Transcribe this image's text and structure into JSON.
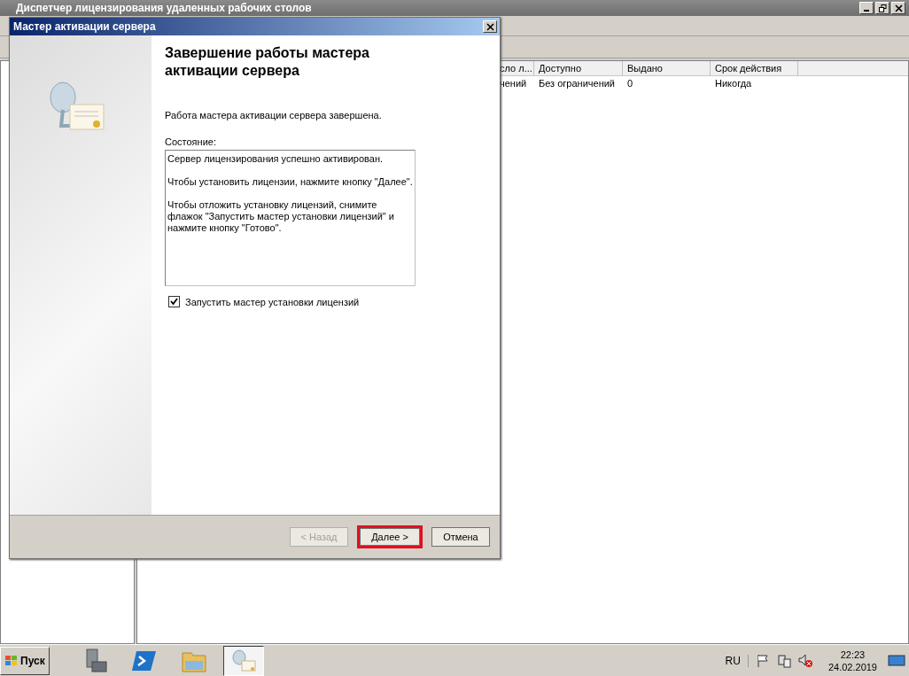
{
  "background_window": {
    "title": "Диспетчер лицензирования удаленных рабочих столов",
    "table": {
      "columns": [
        "сло л...",
        "Доступно",
        "Выдано",
        "Срок действия"
      ],
      "rows": [
        [
          "чений",
          "Без ограничений",
          "0",
          "Никогда"
        ]
      ]
    }
  },
  "dialog": {
    "title": "Мастер активации сервера",
    "heading": "Завершение работы мастера активации сервера",
    "intro": "Работа мастера активации сервера завершена.",
    "status_label": "Состояние:",
    "status_paragraphs": [
      "Сервер лицензирования успешно активирован.",
      "Чтобы установить лицензии, нажмите кнопку \"Далее\".",
      "Чтобы отложить установку лицензий, снимите флажок \"Запустить мастер установки лицензий\" и нажмите кнопку \"Готово\"."
    ],
    "checkbox": {
      "label": "Запустить мастер установки лицензий",
      "checked": true
    },
    "buttons": [
      {
        "label": "< Назад",
        "disabled": true,
        "highlighted": false
      },
      {
        "label": "Далее >",
        "disabled": false,
        "highlighted": true
      },
      {
        "label": "Отмена",
        "disabled": false,
        "highlighted": false
      }
    ]
  },
  "taskbar": {
    "start_label": "Пуск",
    "apps": [
      {
        "kind": "server",
        "selected": false
      },
      {
        "kind": "powershell",
        "selected": false
      },
      {
        "kind": "folder",
        "selected": false
      },
      {
        "kind": "license",
        "selected": true
      }
    ],
    "language": "RU",
    "time": "22:23",
    "date": "24.02.2019"
  }
}
